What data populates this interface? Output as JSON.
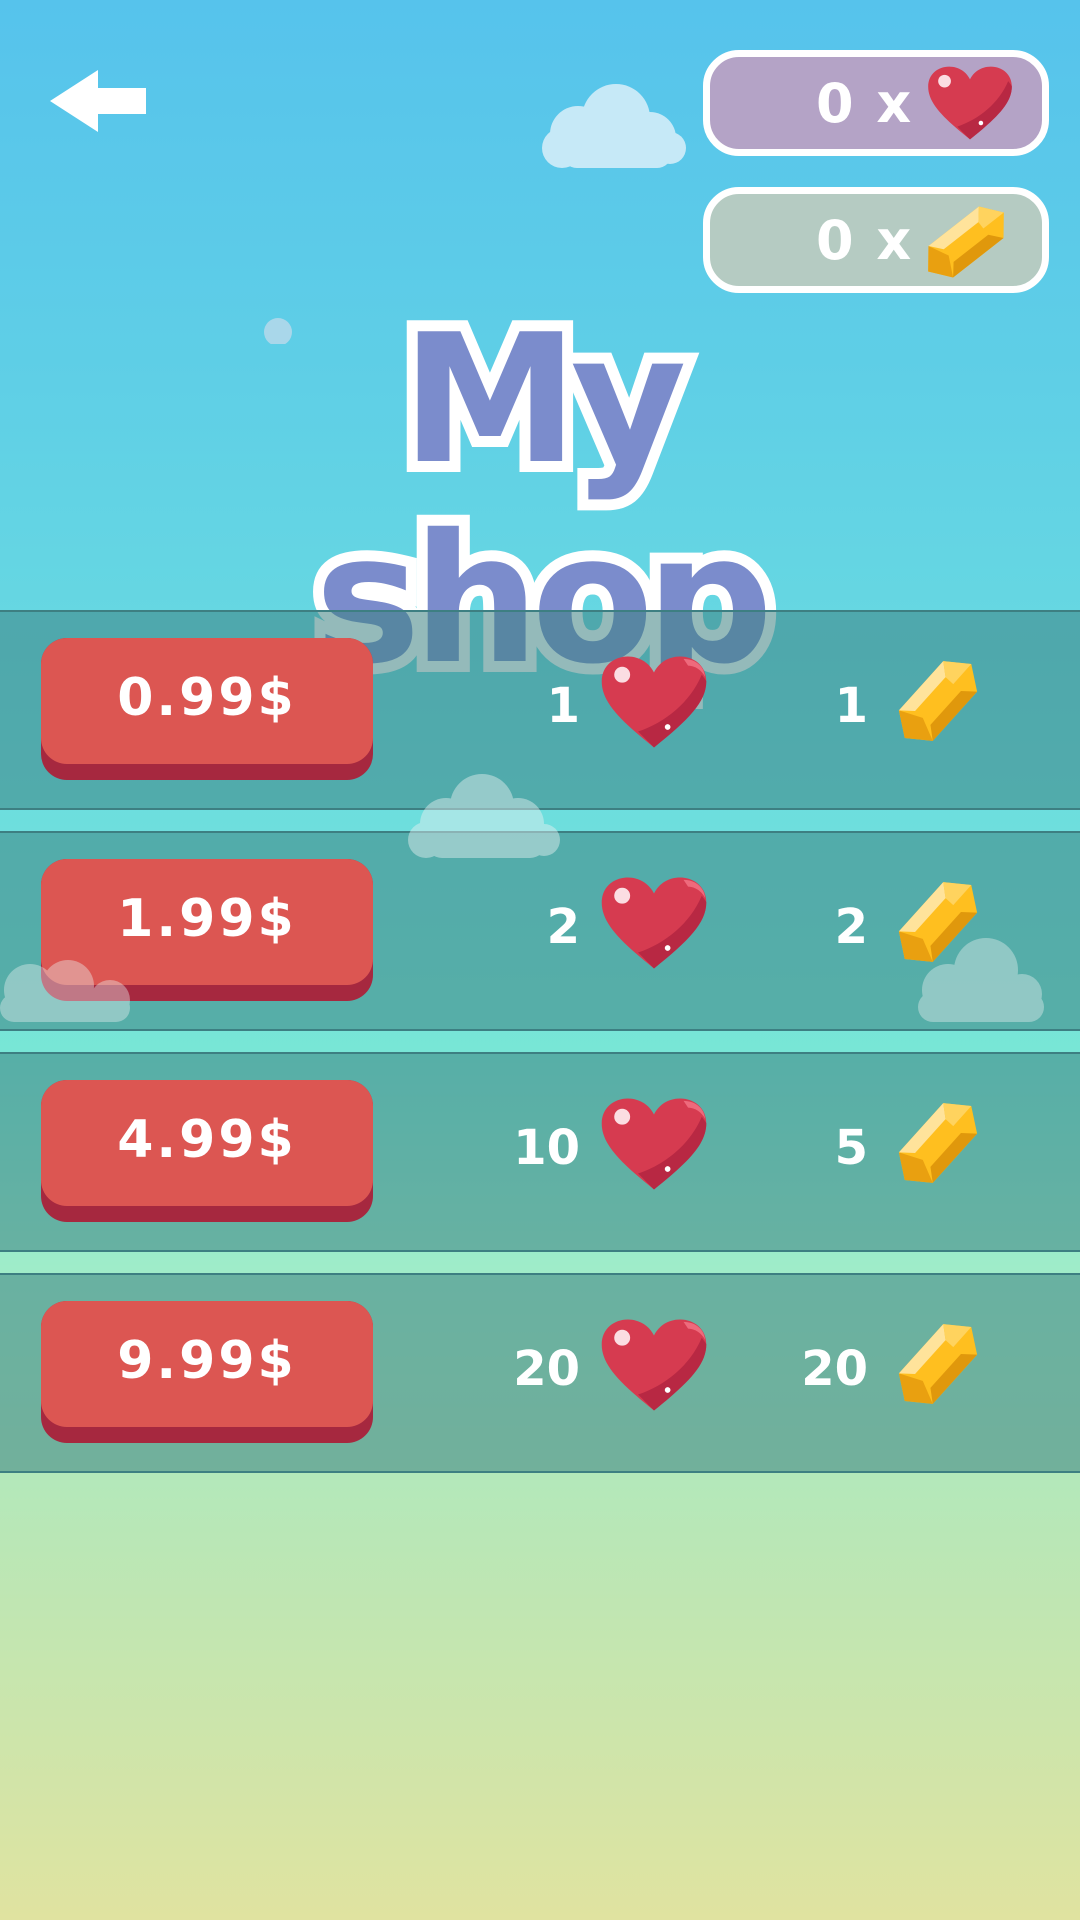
{
  "header": {
    "back_icon": "back-arrow-icon",
    "hearts_counter": {
      "value": "0 x",
      "icon": "heart-icon"
    },
    "gems_counter": {
      "value": "0 x",
      "icon": "gem-icon"
    }
  },
  "title": "My shop",
  "shop_items": [
    {
      "price": "0.99$",
      "hearts": "1",
      "gems": "1"
    },
    {
      "price": "1.99$",
      "hearts": "2",
      "gems": "2"
    },
    {
      "price": "4.99$",
      "hearts": "10",
      "gems": "5"
    },
    {
      "price": "9.99$",
      "hearts": "20",
      "gems": "20"
    }
  ],
  "colors": {
    "price_button": "#dc5652",
    "price_button_shadow": "#a6283f",
    "title": "#7b8ccc",
    "heart": "#d63b50",
    "gem": "#ffbf1f"
  }
}
